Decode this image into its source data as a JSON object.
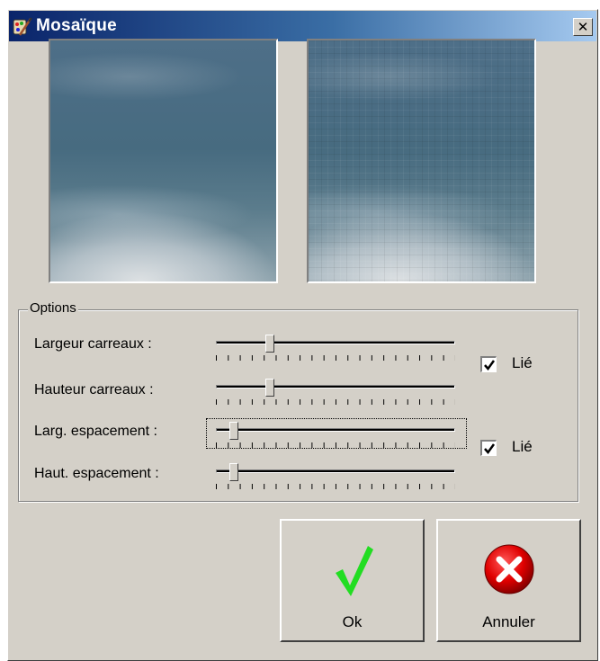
{
  "window": {
    "title": "Mosaïque",
    "close_glyph": "✕",
    "app_icon": "paint-palette-icon"
  },
  "options": {
    "group_label": "Options",
    "sliders": [
      {
        "label": "Largeur carreaux :",
        "value": 0.22
      },
      {
        "label": "Hauteur carreaux :",
        "value": 0.22
      },
      {
        "label": "Larg. espacement :",
        "value": 0.07
      },
      {
        "label": "Haut. espacement :",
        "value": 0.07
      }
    ],
    "links": [
      {
        "label": "Lié",
        "checked": true
      },
      {
        "label": "Lié",
        "checked": true
      }
    ]
  },
  "buttons": {
    "ok_label": "Ok",
    "cancel_label": "Annuler",
    "ok_icon": "green-checkmark-icon",
    "cancel_icon": "red-x-circle-icon"
  },
  "colors": {
    "title_bar_start": "#0a246a",
    "title_bar_end": "#a6caf0",
    "dialog_bg": "#d4d0c8",
    "ok_check": "#22dd22",
    "cancel_red": "#e00000"
  }
}
